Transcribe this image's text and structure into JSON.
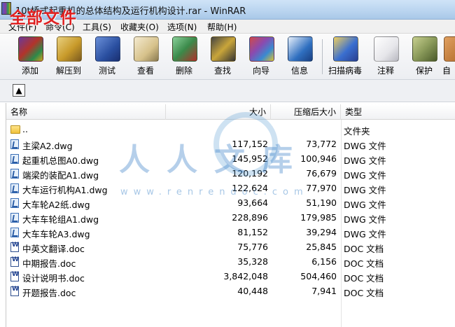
{
  "window": {
    "title": "10t桥式起重机的总体结构及运行机构设计.rar - WinRAR",
    "overlay_title": "全部文件"
  },
  "menu": [
    {
      "label": "文件(F)"
    },
    {
      "label": "命令(C)"
    },
    {
      "label": "工具(S)"
    },
    {
      "label": "收藏夹(O)"
    },
    {
      "label": "选项(N)"
    },
    {
      "label": "帮助(H)"
    }
  ],
  "toolbar": [
    {
      "label": "添加",
      "icon": "add-archive-icon",
      "color": "#b2342a"
    },
    {
      "label": "解压到",
      "icon": "extract-to-icon",
      "color": "#c89a2a"
    },
    {
      "label": "测试",
      "icon": "test-icon",
      "color": "#2a4fa0"
    },
    {
      "label": "查看",
      "icon": "view-icon",
      "color": "#d6c18a"
    },
    {
      "label": "删除",
      "icon": "delete-icon",
      "color": "#3b8a4a"
    },
    {
      "label": "查找",
      "icon": "find-icon",
      "color": "#c9a53a"
    },
    {
      "label": "向导",
      "icon": "wizard-icon",
      "color": "#8a4ab0"
    },
    {
      "label": "信息",
      "icon": "info-icon",
      "color": "#2f6fc0"
    },
    {
      "label": "扫描病毒",
      "icon": "scan-virus-icon",
      "color": "#3a6fd0"
    },
    {
      "label": "注释",
      "icon": "comment-icon",
      "color": "#e6e6ea"
    },
    {
      "label": "保护",
      "icon": "protect-icon",
      "color": "#8a9a5a"
    },
    {
      "label": "自",
      "icon": "sfx-icon",
      "color": "#b06a2a"
    }
  ],
  "columns": {
    "name": "名称",
    "size": "大小",
    "packed": "压缩后大小",
    "type": "类型"
  },
  "files": [
    {
      "name": "..",
      "size": "",
      "packed": "",
      "type": "文件夹",
      "icon": "folder"
    },
    {
      "name": "主梁A2.dwg",
      "size": "117,152",
      "packed": "73,772",
      "type": "DWG 文件",
      "icon": "dwg"
    },
    {
      "name": "起重机总图A0.dwg",
      "size": "145,952",
      "packed": "100,946",
      "type": "DWG 文件",
      "icon": "dwg"
    },
    {
      "name": "端梁的装配A1.dwg",
      "size": "120,192",
      "packed": "76,679",
      "type": "DWG 文件",
      "icon": "dwg"
    },
    {
      "name": "大车运行机构A1.dwg",
      "size": "122,624",
      "packed": "77,970",
      "type": "DWG 文件",
      "icon": "dwg"
    },
    {
      "name": "大车轮A2纸.dwg",
      "size": "93,664",
      "packed": "51,190",
      "type": "DWG 文件",
      "icon": "dwg"
    },
    {
      "name": "大车车轮组A1.dwg",
      "size": "228,896",
      "packed": "179,985",
      "type": "DWG 文件",
      "icon": "dwg"
    },
    {
      "name": "大车车轮A3.dwg",
      "size": "81,152",
      "packed": "39,294",
      "type": "DWG 文件",
      "icon": "dwg"
    },
    {
      "name": "中英文翻译.doc",
      "size": "75,776",
      "packed": "25,845",
      "type": "DOC 文档",
      "icon": "doc"
    },
    {
      "name": "中期报告.doc",
      "size": "35,328",
      "packed": "6,156",
      "type": "DOC 文档",
      "icon": "doc"
    },
    {
      "name": "设计说明书.doc",
      "size": "3,842,048",
      "packed": "504,460",
      "type": "DOC 文档",
      "icon": "doc"
    },
    {
      "name": "开题报告.doc",
      "size": "40,448",
      "packed": "7,941",
      "type": "DOC 文档",
      "icon": "doc"
    }
  ],
  "watermark": {
    "text": "人人文库",
    "url": "www.renrendoc.com"
  }
}
